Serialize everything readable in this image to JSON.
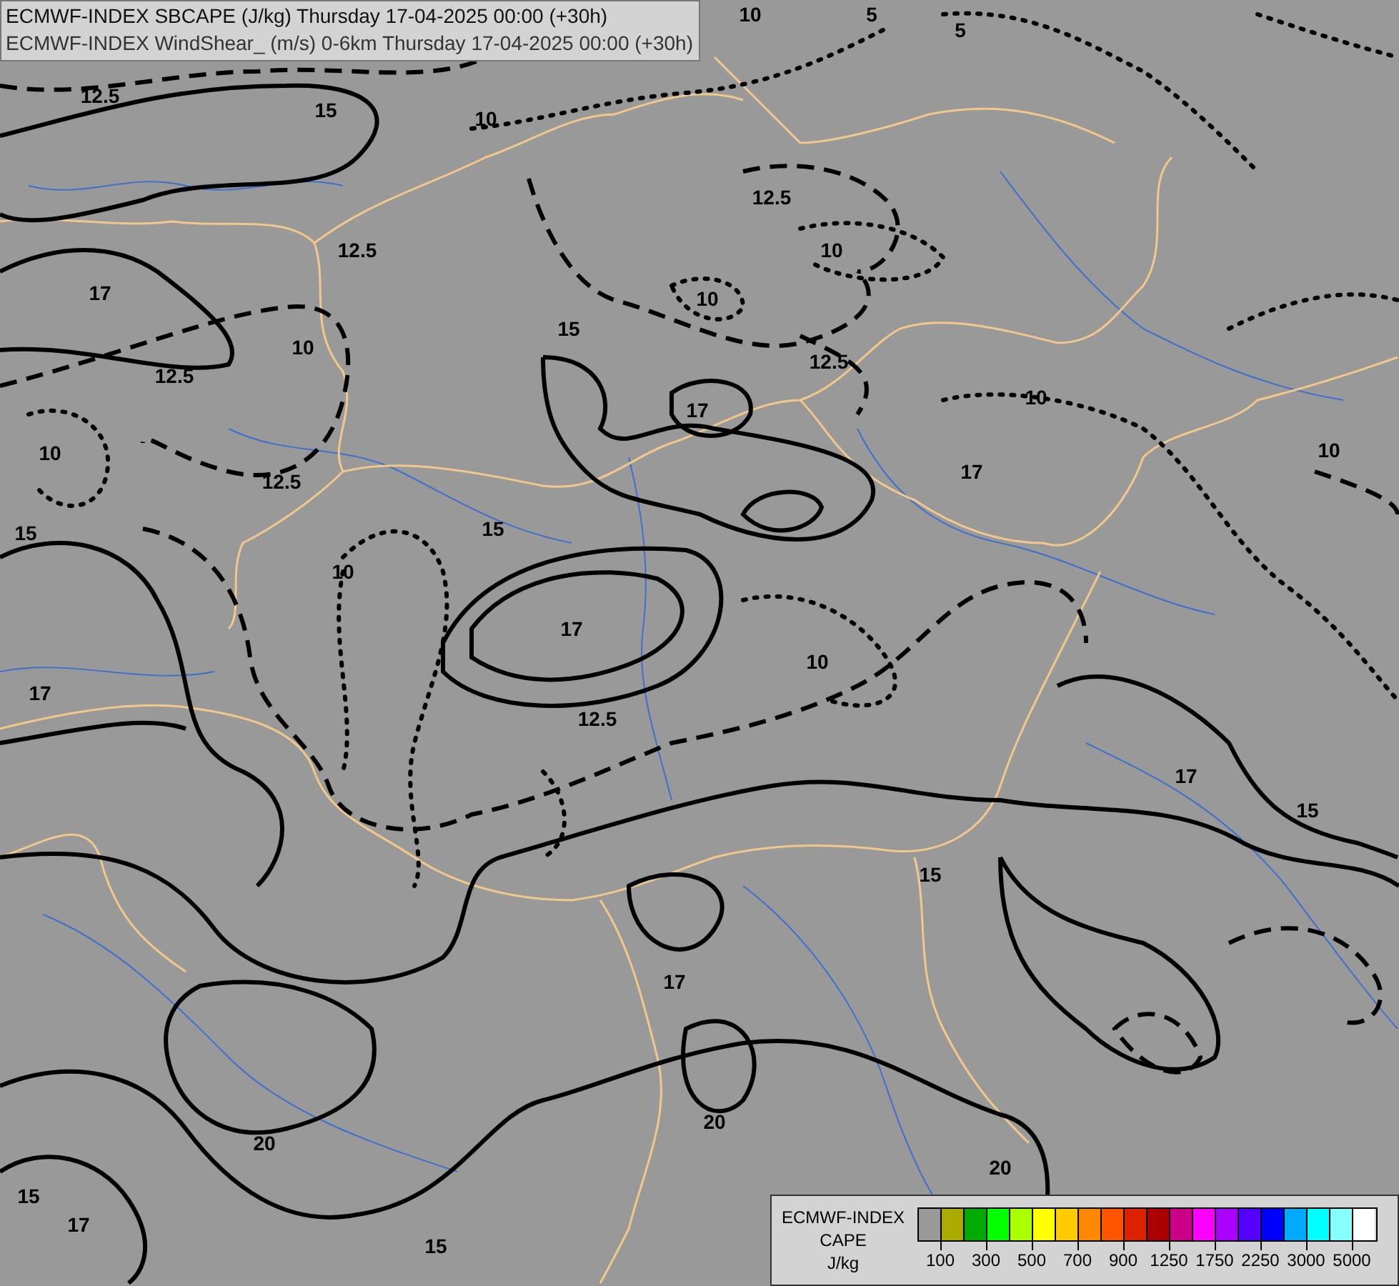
{
  "header": {
    "lines": [
      "ECMWF-INDEX SBCAPE (J/kg) Thursday 17-04-2025 00:00 (+30h)",
      "ECMWF-INDEX WindShear_ (m/s) 0-6km Thursday 17-04-2025 00:00 (+30h)"
    ]
  },
  "map": {
    "contour_labels": [
      "12.5",
      "15",
      "10",
      "10",
      "5",
      "5",
      "12.5",
      "10",
      "12.5",
      "17",
      "10",
      "10",
      "12.5",
      "15",
      "17",
      "12.5",
      "10",
      "10",
      "12.5",
      "10",
      "15",
      "17",
      "10",
      "15",
      "17",
      "10",
      "12.5",
      "17",
      "17",
      "15",
      "15",
      "17",
      "20",
      "20",
      "20",
      "15",
      "17",
      "15"
    ]
  },
  "legend": {
    "title_lines": [
      "ECMWF-INDEX",
      "CAPE",
      "J/kg"
    ],
    "bins": [
      {
        "color": "#999999",
        "label": "100"
      },
      {
        "color": "#aaaa00"
      },
      {
        "color": "#00aa00",
        "label": "300"
      },
      {
        "color": "#00ff00"
      },
      {
        "color": "#aaff00",
        "label": "500"
      },
      {
        "color": "#ffff00"
      },
      {
        "color": "#ffcc00",
        "label": "700"
      },
      {
        "color": "#ff8800"
      },
      {
        "color": "#ff5500",
        "label": "900"
      },
      {
        "color": "#dd2200"
      },
      {
        "color": "#aa0000",
        "label": "1250"
      },
      {
        "color": "#cc0088"
      },
      {
        "color": "#ff00ff",
        "label": "1750"
      },
      {
        "color": "#aa00ff"
      },
      {
        "color": "#5500ff",
        "label": "2250"
      },
      {
        "color": "#0000ff"
      },
      {
        "color": "#00aaff",
        "label": "3000"
      },
      {
        "color": "#00ffff"
      },
      {
        "color": "#88ffff",
        "label": "5000"
      },
      {
        "color": "#ffffff"
      }
    ]
  }
}
